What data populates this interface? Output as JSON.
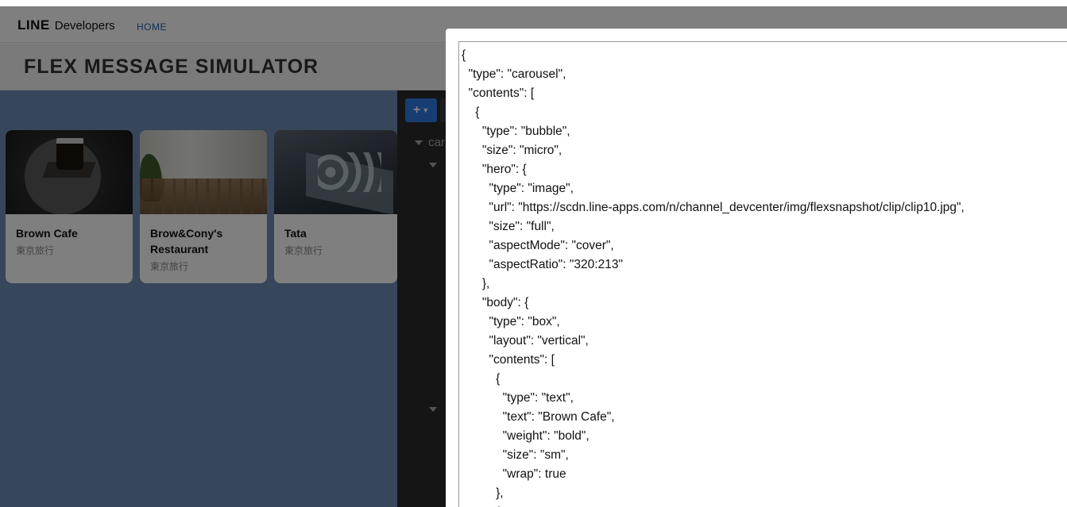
{
  "header": {
    "logo_brand": "LINE",
    "logo_text": "Developers",
    "nav_home": "HOME"
  },
  "page_title": "FLEX MESSAGE SIMULATOR",
  "preview": {
    "cards": [
      {
        "name": "Brown Cafe",
        "sub": "東京旅行"
      },
      {
        "name": "Brow&Cony's Restaurant",
        "sub": "東京旅行"
      },
      {
        "name": "Tata",
        "sub": "東京旅行"
      }
    ]
  },
  "editor": {
    "add_button": "+",
    "tree_root": "car"
  },
  "modal": {
    "json_lines": [
      "{",
      "  \"type\": \"carousel\",",
      "  \"contents\": [",
      "    {",
      "      \"type\": \"bubble\",",
      "      \"size\": \"micro\",",
      "      \"hero\": {",
      "        \"type\": \"image\",",
      "        \"url\": \"https://scdn.line-apps.com/n/channel_devcenter/img/flexsnapshot/clip/clip10.jpg\",",
      "        \"size\": \"full\",",
      "        \"aspectMode\": \"cover\",",
      "        \"aspectRatio\": \"320:213\"",
      "      },",
      "      \"body\": {",
      "        \"type\": \"box\",",
      "        \"layout\": \"vertical\",",
      "        \"contents\": [",
      "          {",
      "            \"type\": \"text\",",
      "            \"text\": \"Brown Cafe\",",
      "            \"weight\": \"bold\",",
      "            \"size\": \"sm\",",
      "            \"wrap\": true",
      "          },",
      "          {"
    ]
  }
}
